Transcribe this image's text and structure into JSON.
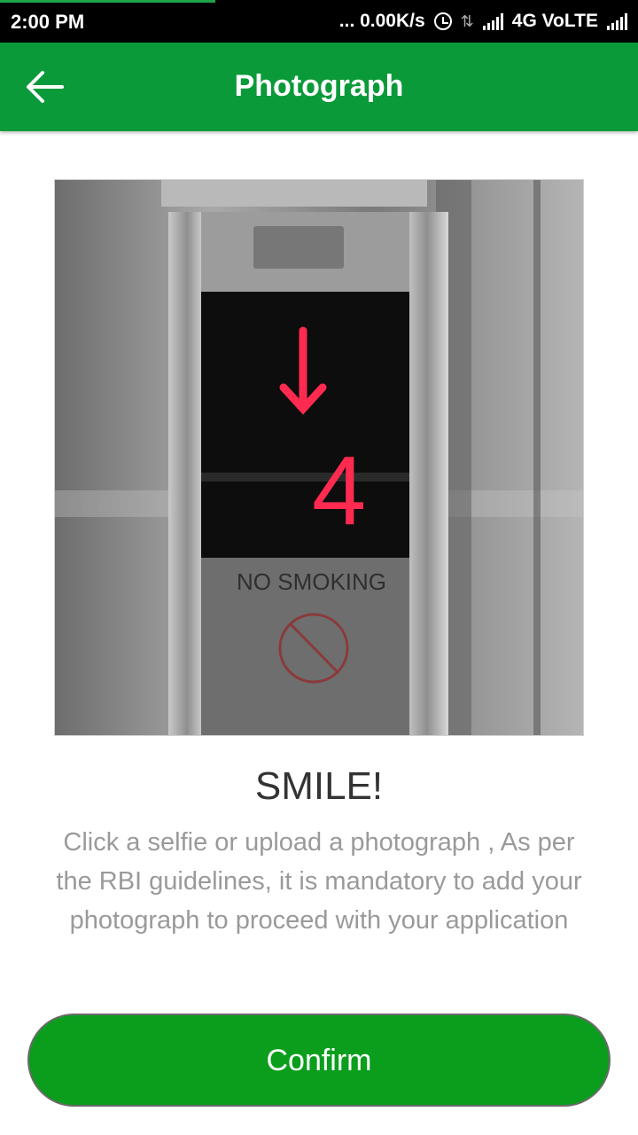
{
  "status_bar": {
    "time": "2:00 PM",
    "network_speed": "... 0.00K/s",
    "network_type": "4G VoLTE",
    "icons": [
      "alarm-icon",
      "data-transfer-icon",
      "signal-icon",
      "signal-icon"
    ]
  },
  "app_bar": {
    "title": "Photograph",
    "back_icon": "arrow-left-icon",
    "color": "#0a9a3a"
  },
  "photo": {
    "display_digit": "4",
    "sign_text": "NO SMOKING"
  },
  "content": {
    "heading": "SMILE!",
    "description": "Click a selfie or upload a photograph , As per the RBI guidelines, it is mandatory to add your photograph to proceed with your application"
  },
  "actions": {
    "confirm_label": "Confirm",
    "button_color": "#0a9e1c"
  }
}
